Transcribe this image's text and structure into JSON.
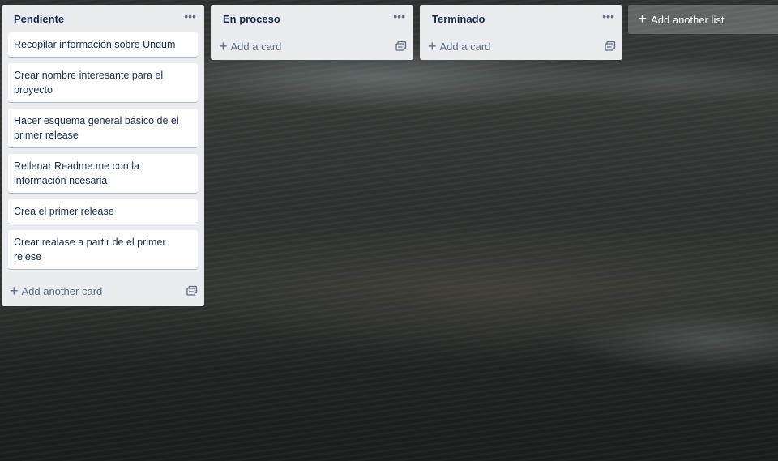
{
  "lists": [
    {
      "title": "Pendiente",
      "menu_icon": "more-horizontal-icon",
      "cards": [
        "Recopilar información sobre Undum",
        "Crear nombre interesante para el proyecto",
        "Hacer esquema general básico de el primer release",
        "Rellenar Readme.me con la información ncesaria",
        "Crea el primer release",
        "Crear realase a partir de el primer relese"
      ],
      "add_label": "Add another card",
      "template_icon": "card-template-icon"
    },
    {
      "title": "En proceso",
      "menu_icon": "more-horizontal-icon",
      "cards": [],
      "add_label": "Add a card",
      "template_icon": "card-template-icon"
    },
    {
      "title": "Terminado",
      "menu_icon": "more-horizontal-icon",
      "cards": [],
      "add_label": "Add a card",
      "template_icon": "card-template-icon"
    }
  ],
  "add_list": {
    "label": "Add another list",
    "icon": "plus-icon"
  },
  "colors": {
    "list_bg": "#ebecf0",
    "card_bg": "#ffffff",
    "title_text": "#172b4d",
    "muted_text": "#5e6c84"
  }
}
